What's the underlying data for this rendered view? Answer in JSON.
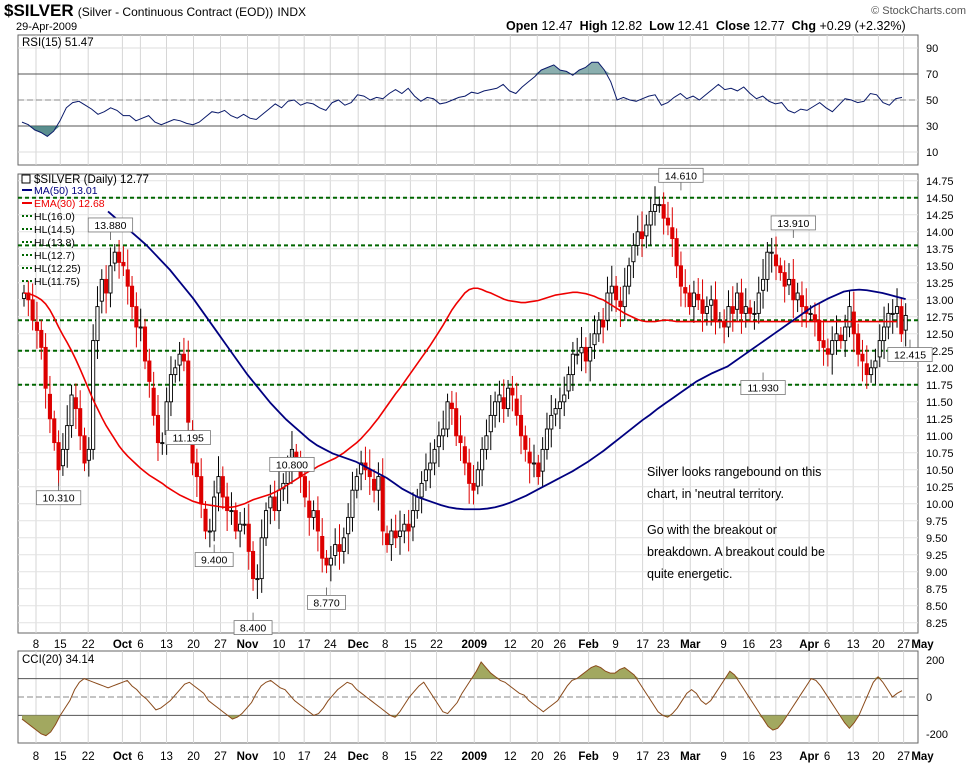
{
  "header": {
    "symbol": "$SILVER",
    "description": "(Silver - Continuous Contract (EOD))",
    "exchange": "INDX",
    "date": "29-Apr-2009",
    "copyright": "© StockCharts.com",
    "open_label": "Open",
    "open": "12.47",
    "high_label": "High",
    "high": "12.82",
    "low_label": "Low",
    "low": "12.41",
    "close_label": "Close",
    "close": "12.77",
    "chg_label": "Chg",
    "chg": "+0.29 (+2.32%)"
  },
  "annotation": {
    "line1": "Silver looks rangebound on this",
    "line2": "chart, in 'neutral territory.",
    "line3": "Go with the breakout or",
    "line4": "breakdown.  A breakout could be",
    "line5": "quite energetic."
  },
  "colors": {
    "up": "#000000",
    "down": "#dd0000",
    "ma50": "#000080",
    "ema30": "#ee0000",
    "hl": "#006600",
    "rsi": "#0a1a6a",
    "rsi_fill": "#3d7a7a",
    "cci": "#8a4a1a",
    "cci_fill": "#a2a860"
  },
  "chart_data": [
    {
      "type": "line",
      "name": "rsi",
      "legend": "RSI(15) 51.47",
      "ylim": [
        0,
        100
      ],
      "yticks": [
        10,
        30,
        50,
        70,
        90
      ],
      "guide_lines": [
        30,
        70
      ],
      "center_line": 50,
      "values": [
        33,
        31,
        27,
        25,
        22,
        26,
        34,
        44,
        48,
        49,
        46,
        43,
        39,
        41,
        44,
        42,
        38,
        38,
        34,
        36,
        38,
        33,
        31,
        33,
        35,
        34,
        32,
        31,
        33,
        37,
        41,
        40,
        42,
        38,
        36,
        39,
        36,
        35,
        39,
        43,
        47,
        44,
        49,
        50,
        46,
        48,
        47,
        44,
        42,
        48,
        50,
        46,
        48,
        54,
        53,
        50,
        52,
        51,
        55,
        58,
        55,
        59,
        53,
        49,
        52,
        51,
        47,
        48,
        50,
        52,
        53,
        56,
        55,
        57,
        58,
        59,
        62,
        57,
        55,
        60,
        64,
        68,
        73,
        75,
        77,
        73,
        72,
        69,
        73,
        75,
        79,
        79,
        73,
        64,
        50,
        52,
        50,
        49,
        51,
        53,
        54,
        46,
        48,
        52,
        55,
        51,
        53,
        50,
        54,
        58,
        62,
        58,
        59,
        57,
        60,
        55,
        51,
        53,
        49,
        47,
        48,
        42,
        40,
        43,
        42,
        45,
        48,
        44,
        41,
        46,
        51,
        50,
        48,
        49,
        55,
        54,
        48,
        46,
        51,
        52
      ]
    },
    {
      "type": "candlestick",
      "name": "price",
      "legend": "$SILVER (Daily) 12.77",
      "ylim": [
        8.1,
        14.85
      ],
      "yticks": [
        8.25,
        8.5,
        8.75,
        9.0,
        9.25,
        9.5,
        9.75,
        10.0,
        10.25,
        10.5,
        10.75,
        11.0,
        11.25,
        11.5,
        11.75,
        12.0,
        12.25,
        12.5,
        12.75,
        13.0,
        13.25,
        13.5,
        13.75,
        14.0,
        14.25,
        14.5,
        14.75
      ],
      "close": [
        13.1,
        13.0,
        12.7,
        12.55,
        12.3,
        11.7,
        11.25,
        10.9,
        10.5,
        10.8,
        11.15,
        11.6,
        11.4,
        11.0,
        10.6,
        10.8,
        12.4,
        12.9,
        13.3,
        13.1,
        13.5,
        13.7,
        13.55,
        13.5,
        13.2,
        12.9,
        12.6,
        12.6,
        12.1,
        11.8,
        11.3,
        10.9,
        10.9,
        11.5,
        11.9,
        12.0,
        12.2,
        12.1,
        11.2,
        10.6,
        10.4,
        10.0,
        9.6,
        9.6,
        10.1,
        10.4,
        10.1,
        9.9,
        9.9,
        9.6,
        9.7,
        9.7,
        9.3,
        8.9,
        8.9,
        9.5,
        9.9,
        10.1,
        9.9,
        10.2,
        10.3,
        10.5,
        10.8,
        10.6,
        10.4,
        10.1,
        9.8,
        9.9,
        9.6,
        9.2,
        9.1,
        9.2,
        9.4,
        9.3,
        9.5,
        9.8,
        10.2,
        10.4,
        10.6,
        10.5,
        10.4,
        10.2,
        10.4,
        9.6,
        9.4,
        9.6,
        9.5,
        9.6,
        9.7,
        9.6,
        9.9,
        10.1,
        10.3,
        10.5,
        10.6,
        10.8,
        11.0,
        11.1,
        11.5,
        11.4,
        11.0,
        10.9,
        10.6,
        10.3,
        10.2,
        10.5,
        10.8,
        11.0,
        11.3,
        11.5,
        11.6,
        11.4,
        11.7,
        11.6,
        11.3,
        11.0,
        10.8,
        10.6,
        10.6,
        10.4,
        10.8,
        11.1,
        11.3,
        11.4,
        11.5,
        11.6,
        11.9,
        12.2,
        12.2,
        12.3,
        12.1,
        12.3,
        12.5,
        12.7,
        12.6,
        13.1,
        13.2,
        13.0,
        12.9,
        13.2,
        13.5,
        13.8,
        14.0,
        13.9,
        14.1,
        14.3,
        14.4,
        14.4,
        14.2,
        14.1,
        13.9,
        13.5,
        13.2,
        13.1,
        12.9,
        13.1,
        13.0,
        12.8,
        12.9,
        13.0,
        12.7,
        12.7,
        12.6,
        12.9,
        12.8,
        13.1,
        12.8,
        12.9,
        12.8,
        12.8,
        13.1,
        13.3,
        13.7,
        13.7,
        13.5,
        13.4,
        13.2,
        13.3,
        13.0,
        13.1,
        12.9,
        12.8,
        12.8,
        12.7,
        12.4,
        12.3,
        12.2,
        12.4,
        12.5,
        12.4,
        12.6,
        12.9,
        12.5,
        12.2,
        12.1,
        11.9,
        12.0,
        12.1,
        12.4,
        12.6,
        12.8,
        12.8,
        12.9,
        12.5,
        12.77
      ],
      "ma50": [
        14.3,
        14.2,
        14.1,
        14.0,
        13.9,
        13.8,
        13.68,
        13.56,
        13.44,
        13.3,
        13.16,
        13.02,
        12.86,
        12.7,
        12.54,
        12.38,
        12.22,
        12.06,
        11.9,
        11.76,
        11.62,
        11.48,
        11.36,
        11.24,
        11.14,
        11.04,
        10.94,
        10.86,
        10.8,
        10.74,
        10.7,
        10.66,
        10.62,
        10.56,
        10.5,
        10.44,
        10.38,
        10.3,
        10.22,
        10.16,
        10.1,
        10.06,
        10.02,
        9.98,
        9.95,
        9.93,
        9.92,
        9.92,
        9.92,
        9.93,
        9.95,
        9.98,
        10.02,
        10.07,
        10.12,
        10.18,
        10.24,
        10.3,
        10.36,
        10.42,
        10.48,
        10.55,
        10.62,
        10.7,
        10.78,
        10.87,
        10.96,
        11.05,
        11.14,
        11.23,
        11.31,
        11.4,
        11.48,
        11.56,
        11.64,
        11.72,
        11.8,
        11.86,
        11.92,
        11.97,
        12.02,
        12.1,
        12.18,
        12.26,
        12.34,
        12.42,
        12.5,
        12.58,
        12.66,
        12.74,
        12.82,
        12.9,
        12.96,
        13.02,
        13.07,
        13.12,
        13.14,
        13.15,
        13.14,
        13.12,
        13.1,
        13.07,
        13.04,
        13.01
      ],
      "ma50_start_index": 106,
      "ema30": [
        13.1,
        13.09,
        13.07,
        13.04,
        13.0,
        12.94,
        12.85,
        12.73,
        12.6,
        12.48,
        12.37,
        12.25,
        12.12,
        11.98,
        11.83,
        11.68,
        11.53,
        11.4,
        11.27,
        11.15,
        11.05,
        10.95,
        10.85,
        10.77,
        10.7,
        10.64,
        10.58,
        10.52,
        10.47,
        10.42,
        10.38,
        10.34,
        10.3,
        10.25,
        10.21,
        10.17,
        10.13,
        10.1,
        10.07,
        10.04,
        10.02,
        10.0,
        9.99,
        9.98,
        9.97,
        9.96,
        9.95,
        9.95,
        9.95,
        9.96,
        9.98,
        10.0,
        10.03,
        10.06,
        10.08,
        10.1,
        10.12,
        10.14,
        10.17,
        10.2,
        10.24,
        10.28,
        10.32,
        10.36,
        10.4,
        10.44,
        10.48,
        10.51,
        10.55,
        10.58,
        10.61,
        10.64,
        10.67,
        10.71,
        10.75,
        10.8,
        10.85,
        10.9,
        10.96,
        11.03,
        11.1,
        11.18,
        11.26,
        11.35,
        11.44,
        11.53,
        11.62,
        11.7,
        11.79,
        11.88,
        11.97,
        12.06,
        12.15,
        12.24,
        12.33,
        12.43,
        12.53,
        12.63,
        12.74,
        12.85,
        12.94,
        13.02,
        13.1,
        13.15,
        13.17,
        13.17,
        13.15,
        13.12,
        13.1,
        13.07,
        13.04,
        13.01,
        12.99,
        12.98,
        12.97,
        12.96,
        12.96,
        12.97,
        12.98,
        12.99,
        13.01,
        13.03,
        13.05,
        13.07,
        13.08,
        13.09,
        13.1,
        13.11,
        13.11,
        13.1,
        13.09,
        13.07,
        13.05,
        13.02,
        13.0,
        12.96,
        12.92,
        12.88,
        12.84,
        12.8,
        12.77,
        12.74,
        12.71,
        12.69,
        12.68,
        12.68,
        12.68,
        12.69,
        12.7,
        12.7,
        12.69,
        12.68,
        12.68,
        12.68,
        12.68,
        12.68,
        12.68,
        12.68,
        12.68,
        12.68,
        12.68,
        12.68,
        12.68,
        12.68,
        12.68,
        12.68,
        12.68,
        12.68,
        12.68,
        12.68,
        12.68,
        12.68,
        12.68,
        12.68,
        12.68,
        12.68,
        12.68,
        12.68,
        12.68,
        12.68,
        12.68,
        12.68,
        12.68,
        12.68,
        12.68,
        12.68,
        12.68,
        12.68,
        12.68,
        12.68,
        12.68,
        12.68,
        12.68,
        12.68,
        12.68,
        12.68,
        12.68,
        12.68,
        12.68,
        12.68,
        12.68,
        12.68,
        12.68
      ],
      "hlines": [
        {
          "label": "HL(16.0)",
          "value": 16.0
        },
        {
          "label": "HL(14.5)",
          "value": 14.5
        },
        {
          "label": "HL(13.8)",
          "value": 13.8
        },
        {
          "label": "HL(12.7)",
          "value": 12.7
        },
        {
          "label": "HL(12.25)",
          "value": 12.25
        },
        {
          "label": "HL(11.75)",
          "value": 11.75
        }
      ],
      "legend_ma50": "MA(50) 13.01",
      "legend_ema30": "EMA(30) 12.68",
      "callouts": [
        {
          "label": "13.880",
          "index": 20,
          "value": 13.88
        },
        {
          "label": "10.310",
          "index": 8,
          "value": 10.31
        },
        {
          "label": "11.195",
          "index": 38,
          "value": 11.195
        },
        {
          "label": "9.400",
          "index": 44,
          "value": 9.4
        },
        {
          "label": "10.800",
          "index": 62,
          "value": 10.8
        },
        {
          "label": "8.400",
          "index": 53,
          "value": 8.4
        },
        {
          "label": "8.770",
          "index": 70,
          "value": 8.77
        },
        {
          "label": "14.610",
          "index": 152,
          "value": 14.61
        },
        {
          "label": "13.910",
          "index": 178,
          "value": 13.91
        },
        {
          "label": "11.930",
          "index": 171,
          "value": 11.93
        },
        {
          "label": "12.415",
          "index": 205,
          "value": 12.415
        }
      ]
    },
    {
      "type": "line",
      "name": "cci",
      "legend": "CCI(20) 34.14",
      "ylim": [
        -250,
        250
      ],
      "yticks": [
        -200,
        0,
        200
      ],
      "guide_lines": [
        -100,
        100
      ],
      "center_line": 0,
      "values": [
        -120,
        -140,
        -160,
        -180,
        -200,
        -210,
        -190,
        -150,
        -100,
        -60,
        -20,
        40,
        80,
        100,
        90,
        80,
        70,
        60,
        50,
        60,
        70,
        80,
        90,
        60,
        40,
        10,
        -10,
        -40,
        -70,
        -60,
        -40,
        -20,
        10,
        40,
        70,
        80,
        60,
        40,
        20,
        -20,
        -40,
        -60,
        -80,
        -100,
        -120,
        -110,
        -90,
        -60,
        -30,
        20,
        60,
        80,
        90,
        70,
        50,
        40,
        10,
        -20,
        -40,
        -60,
        -80,
        -100,
        -90,
        -60,
        -20,
        10,
        40,
        60,
        80,
        70,
        40,
        20,
        0,
        -20,
        -40,
        -60,
        -80,
        -100,
        -110,
        -80,
        -40,
        0,
        30,
        60,
        80,
        40,
        0,
        -40,
        -80,
        -90,
        -60,
        -30,
        20,
        60,
        100,
        140,
        190,
        160,
        130,
        110,
        90,
        80,
        60,
        40,
        20,
        10,
        -20,
        -40,
        -60,
        -80,
        -60,
        -40,
        -20,
        20,
        60,
        90,
        100,
        120,
        140,
        160,
        170,
        160,
        140,
        130,
        130,
        150,
        160,
        140,
        120,
        80,
        40,
        0,
        -40,
        -80,
        -100,
        -110,
        -90,
        -60,
        -20,
        20,
        40,
        20,
        -20,
        -40,
        -20,
        20,
        60,
        100,
        140,
        120,
        80,
        40,
        0,
        -40,
        -80,
        -120,
        -160,
        -180,
        -170,
        -140,
        -100,
        -60,
        -20,
        20,
        60,
        100,
        90,
        60,
        20,
        -20,
        -60,
        -100,
        -140,
        -170,
        -140,
        -100,
        -40,
        20,
        80,
        110,
        80,
        40,
        0,
        20,
        34
      ]
    }
  ],
  "x_axis": {
    "labels": [
      {
        "text": "8",
        "frac": 0.02
      },
      {
        "text": "15",
        "frac": 0.047
      },
      {
        "text": "22",
        "frac": 0.078
      },
      {
        "text": "Oct",
        "frac": 0.116,
        "bold": true
      },
      {
        "text": "6",
        "frac": 0.136
      },
      {
        "text": "13",
        "frac": 0.165
      },
      {
        "text": "20",
        "frac": 0.195
      },
      {
        "text": "27",
        "frac": 0.225
      },
      {
        "text": "Nov",
        "frac": 0.255,
        "bold": true
      },
      {
        "text": "10",
        "frac": 0.29
      },
      {
        "text": "17",
        "frac": 0.318
      },
      {
        "text": "24",
        "frac": 0.347
      },
      {
        "text": "Dec",
        "frac": 0.378,
        "bold": true
      },
      {
        "text": "8",
        "frac": 0.408
      },
      {
        "text": "15",
        "frac": 0.436
      },
      {
        "text": "22",
        "frac": 0.465
      },
      {
        "text": "2009",
        "frac": 0.507,
        "bold": true
      },
      {
        "text": "12",
        "frac": 0.547
      },
      {
        "text": "20",
        "frac": 0.577
      },
      {
        "text": "26",
        "frac": 0.602
      },
      {
        "text": "Feb",
        "frac": 0.634,
        "bold": true
      },
      {
        "text": "9",
        "frac": 0.664
      },
      {
        "text": "17",
        "frac": 0.694
      },
      {
        "text": "23",
        "frac": 0.717
      },
      {
        "text": "Mar",
        "frac": 0.747,
        "bold": true
      },
      {
        "text": "9",
        "frac": 0.784
      },
      {
        "text": "16",
        "frac": 0.812
      },
      {
        "text": "23",
        "frac": 0.842
      },
      {
        "text": "Apr",
        "frac": 0.879,
        "bold": true
      },
      {
        "text": "6",
        "frac": 0.899
      },
      {
        "text": "13",
        "frac": 0.928
      },
      {
        "text": "20",
        "frac": 0.956
      },
      {
        "text": "27",
        "frac": 0.984
      },
      {
        "text": "May",
        "frac": 1.005,
        "bold": true
      }
    ]
  }
}
